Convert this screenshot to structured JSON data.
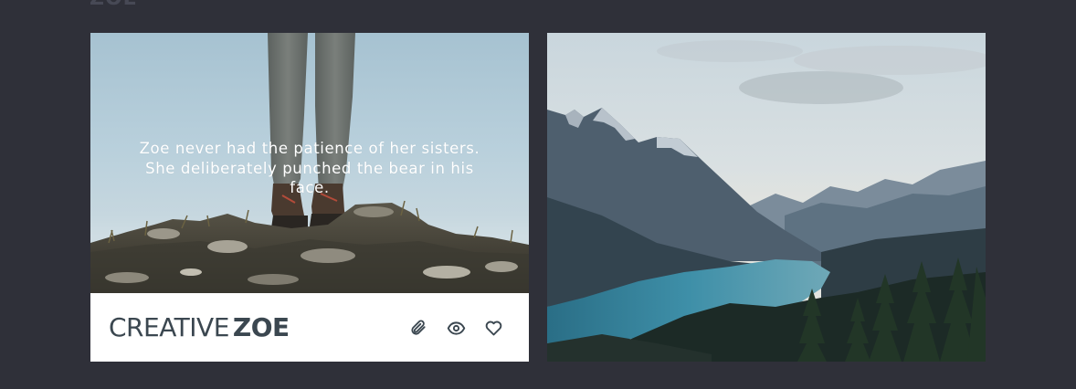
{
  "page": {
    "heading": "ZOE"
  },
  "card": {
    "caption": "Zoe never had the patience of her sisters. She deliberately punched the bear in his face.",
    "logo_light": "CREATIVE",
    "logo_bold": "ZOE",
    "actions": [
      {
        "icon": "paperclip-icon"
      },
      {
        "icon": "eye-icon"
      },
      {
        "icon": "heart-icon"
      }
    ]
  },
  "colors": {
    "background": "#2f3039",
    "logo_text": "#3b4750",
    "card_background": "#ffffff"
  }
}
